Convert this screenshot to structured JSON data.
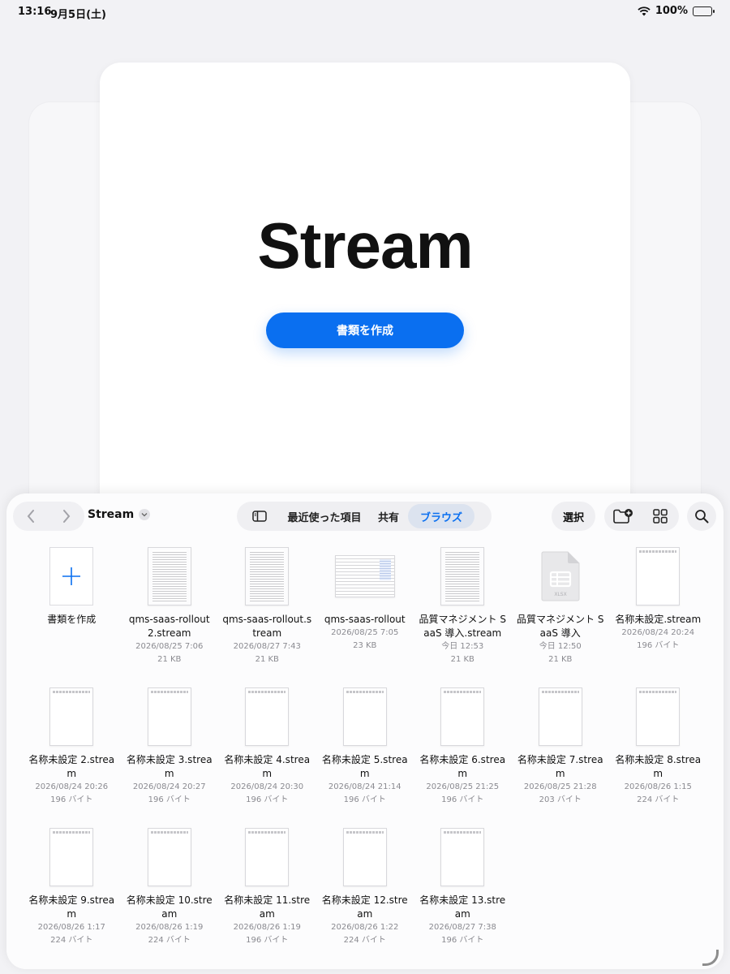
{
  "status_bar": {
    "time": "13:16",
    "date": "9月5日(土)",
    "battery": "100%"
  },
  "app": {
    "title": "Stream",
    "create_button": "書類を作成"
  },
  "browser": {
    "folder": "Stream",
    "tabs": {
      "recent": "最近使った項目",
      "shared": "共有",
      "browse": "ブラウズ"
    },
    "select": "選択",
    "accent": "#0a6ff0",
    "files": [
      {
        "name": "書類を作成",
        "date": "",
        "size": "",
        "thumb": "add"
      },
      {
        "name": "qms-saas-rollout 2.stream",
        "date": "2026/08/25 7:06",
        "size": "21 KB",
        "thumb": "dense"
      },
      {
        "name": "qms-saas-rollout.stream",
        "date": "2026/08/27 7:43",
        "size": "21 KB",
        "thumb": "dense"
      },
      {
        "name": "qms-saas-rollout",
        "date": "2026/08/25 7:05",
        "size": "23 KB",
        "thumb": "wide"
      },
      {
        "name": "品質マネジメント SaaS 導入.stream",
        "date": "今日 12:53",
        "size": "21 KB",
        "thumb": "dense"
      },
      {
        "name": "品質マネジメント SaaS 導入",
        "date": "今日 12:50",
        "size": "21 KB",
        "thumb": "xlsx",
        "badge": "XLSX"
      },
      {
        "name": "名称未設定.stream",
        "date": "2026/08/24 20:24",
        "size": "196 バイト",
        "thumb": "blank"
      },
      {
        "name": "名称未設定 2.stream",
        "date": "2026/08/24 20:26",
        "size": "196 バイト",
        "thumb": "blank"
      },
      {
        "name": "名称未設定 3.stream",
        "date": "2026/08/24 20:27",
        "size": "196 バイト",
        "thumb": "blank"
      },
      {
        "name": "名称未設定 4.stream",
        "date": "2026/08/24 20:30",
        "size": "196 バイト",
        "thumb": "blank"
      },
      {
        "name": "名称未設定 5.stream",
        "date": "2026/08/24 21:14",
        "size": "196 バイト",
        "thumb": "blank"
      },
      {
        "name": "名称未設定 6.stream",
        "date": "2026/08/25 21:25",
        "size": "196 バイト",
        "thumb": "blank"
      },
      {
        "name": "名称未設定 7.stream",
        "date": "2026/08/25 21:28",
        "size": "203 バイト",
        "thumb": "blank"
      },
      {
        "name": "名称未設定 8.stream",
        "date": "2026/08/26 1:15",
        "size": "224 バイト",
        "thumb": "blank"
      },
      {
        "name": "名称未設定 9.stream",
        "date": "2026/08/26 1:17",
        "size": "224 バイト",
        "thumb": "blank"
      },
      {
        "name": "名称未設定 10.stream",
        "date": "2026/08/26 1:19",
        "size": "224 バイト",
        "thumb": "blank"
      },
      {
        "name": "名称未設定 11.stream",
        "date": "2026/08/26 1:19",
        "size": "196 バイト",
        "thumb": "blank"
      },
      {
        "name": "名称未設定 12.stream",
        "date": "2026/08/26 1:22",
        "size": "224 バイト",
        "thumb": "blank"
      },
      {
        "name": "名称未設定 13.stream",
        "date": "2026/08/27 7:38",
        "size": "196 バイト",
        "thumb": "blank"
      }
    ]
  }
}
